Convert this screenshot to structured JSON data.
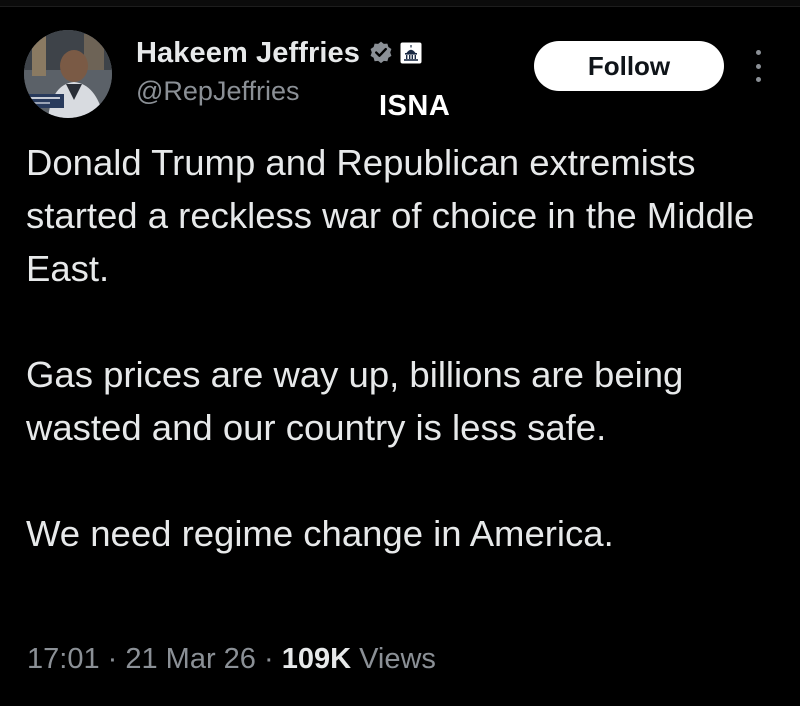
{
  "user": {
    "display_name": "Hakeem Jeffries",
    "handle": "@RepJeffries",
    "verified": true
  },
  "watermark": "ISNA",
  "follow_label": "Follow",
  "tweet": {
    "paragraphs": [
      "Donald Trump and Republican extremists started a reckless war of choice in the Middle East.",
      "Gas prices are way up, billions are being wasted and our country is less safe.",
      "We need regime change in America."
    ]
  },
  "meta": {
    "time": "17:01",
    "separator": " · ",
    "date": "21 Mar 26",
    "views_count": "109K",
    "views_label": " Views"
  },
  "icons": {
    "verified": "verified-badge-icon",
    "government": "capitol-building-icon",
    "more": "more-options-icon"
  },
  "colors": {
    "background": "#000000",
    "primary_text": "#e7e9ea",
    "secondary_text": "#8b9096",
    "follow_bg": "#ffffff"
  }
}
